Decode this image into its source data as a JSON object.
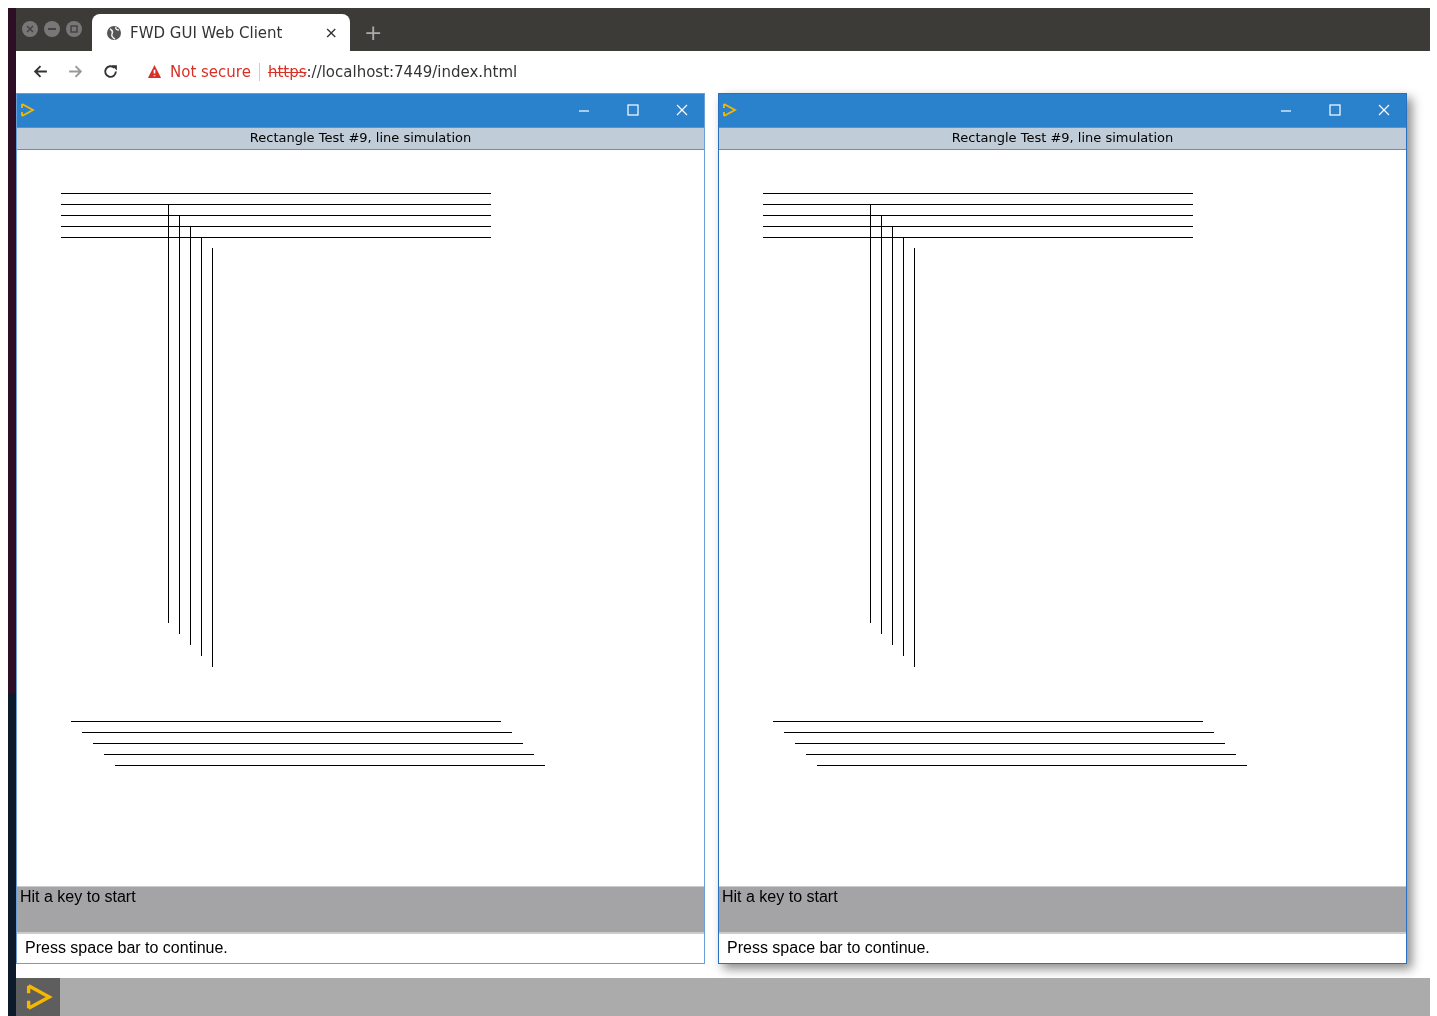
{
  "browser": {
    "tab_title": "FWD GUI Web Client",
    "tab_close": "×",
    "new_tab": "+",
    "security_label": "Not secure",
    "url_scheme": "https",
    "url_rest": "://localhost:7449/index.html"
  },
  "windows": [
    {
      "caption": "Rectangle Test #9, line simulation",
      "message": "Hit a key to start",
      "status": "Press space bar to continue.",
      "focused": false
    },
    {
      "caption": "Rectangle Test #9, line simulation",
      "message": "Hit a key to start",
      "status": "Press space bar to continue.",
      "focused": true
    }
  ]
}
